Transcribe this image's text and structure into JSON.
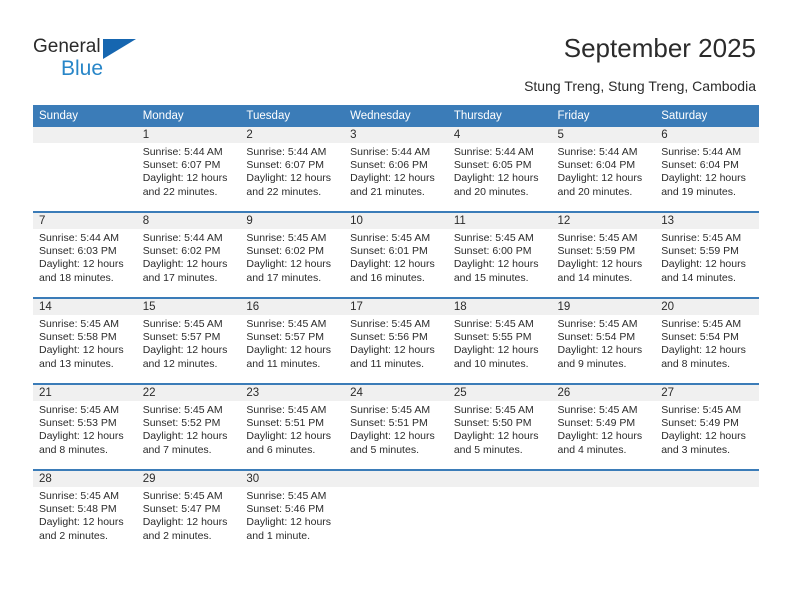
{
  "logo": {
    "word_top": "General",
    "word_bottom": "Blue",
    "triangle_color": "#1666b0",
    "blue_text_color": "#2886c8"
  },
  "header": {
    "title": "September 2025",
    "subtitle": "Stung Treng, Stung Treng, Cambodia",
    "header_bg_color": "#3b7cb8",
    "daynum_band_color": "#f0f0f0"
  },
  "calendar": {
    "weekday_headers": [
      "Sunday",
      "Monday",
      "Tuesday",
      "Wednesday",
      "Thursday",
      "Friday",
      "Saturday"
    ],
    "weeks": [
      [
        {
          "day": "",
          "empty": true
        },
        {
          "day": "1",
          "sunrise": "Sunrise: 5:44 AM",
          "sunset": "Sunset: 6:07 PM",
          "daylight": "Daylight: 12 hours and 22 minutes."
        },
        {
          "day": "2",
          "sunrise": "Sunrise: 5:44 AM",
          "sunset": "Sunset: 6:07 PM",
          "daylight": "Daylight: 12 hours and 22 minutes."
        },
        {
          "day": "3",
          "sunrise": "Sunrise: 5:44 AM",
          "sunset": "Sunset: 6:06 PM",
          "daylight": "Daylight: 12 hours and 21 minutes."
        },
        {
          "day": "4",
          "sunrise": "Sunrise: 5:44 AM",
          "sunset": "Sunset: 6:05 PM",
          "daylight": "Daylight: 12 hours and 20 minutes."
        },
        {
          "day": "5",
          "sunrise": "Sunrise: 5:44 AM",
          "sunset": "Sunset: 6:04 PM",
          "daylight": "Daylight: 12 hours and 20 minutes."
        },
        {
          "day": "6",
          "sunrise": "Sunrise: 5:44 AM",
          "sunset": "Sunset: 6:04 PM",
          "daylight": "Daylight: 12 hours and 19 minutes."
        }
      ],
      [
        {
          "day": "7",
          "sunrise": "Sunrise: 5:44 AM",
          "sunset": "Sunset: 6:03 PM",
          "daylight": "Daylight: 12 hours and 18 minutes."
        },
        {
          "day": "8",
          "sunrise": "Sunrise: 5:44 AM",
          "sunset": "Sunset: 6:02 PM",
          "daylight": "Daylight: 12 hours and 17 minutes."
        },
        {
          "day": "9",
          "sunrise": "Sunrise: 5:45 AM",
          "sunset": "Sunset: 6:02 PM",
          "daylight": "Daylight: 12 hours and 17 minutes."
        },
        {
          "day": "10",
          "sunrise": "Sunrise: 5:45 AM",
          "sunset": "Sunset: 6:01 PM",
          "daylight": "Daylight: 12 hours and 16 minutes."
        },
        {
          "day": "11",
          "sunrise": "Sunrise: 5:45 AM",
          "sunset": "Sunset: 6:00 PM",
          "daylight": "Daylight: 12 hours and 15 minutes."
        },
        {
          "day": "12",
          "sunrise": "Sunrise: 5:45 AM",
          "sunset": "Sunset: 5:59 PM",
          "daylight": "Daylight: 12 hours and 14 minutes."
        },
        {
          "day": "13",
          "sunrise": "Sunrise: 5:45 AM",
          "sunset": "Sunset: 5:59 PM",
          "daylight": "Daylight: 12 hours and 14 minutes."
        }
      ],
      [
        {
          "day": "14",
          "sunrise": "Sunrise: 5:45 AM",
          "sunset": "Sunset: 5:58 PM",
          "daylight": "Daylight: 12 hours and 13 minutes."
        },
        {
          "day": "15",
          "sunrise": "Sunrise: 5:45 AM",
          "sunset": "Sunset: 5:57 PM",
          "daylight": "Daylight: 12 hours and 12 minutes."
        },
        {
          "day": "16",
          "sunrise": "Sunrise: 5:45 AM",
          "sunset": "Sunset: 5:57 PM",
          "daylight": "Daylight: 12 hours and 11 minutes."
        },
        {
          "day": "17",
          "sunrise": "Sunrise: 5:45 AM",
          "sunset": "Sunset: 5:56 PM",
          "daylight": "Daylight: 12 hours and 11 minutes."
        },
        {
          "day": "18",
          "sunrise": "Sunrise: 5:45 AM",
          "sunset": "Sunset: 5:55 PM",
          "daylight": "Daylight: 12 hours and 10 minutes."
        },
        {
          "day": "19",
          "sunrise": "Sunrise: 5:45 AM",
          "sunset": "Sunset: 5:54 PM",
          "daylight": "Daylight: 12 hours and 9 minutes."
        },
        {
          "day": "20",
          "sunrise": "Sunrise: 5:45 AM",
          "sunset": "Sunset: 5:54 PM",
          "daylight": "Daylight: 12 hours and 8 minutes."
        }
      ],
      [
        {
          "day": "21",
          "sunrise": "Sunrise: 5:45 AM",
          "sunset": "Sunset: 5:53 PM",
          "daylight": "Daylight: 12 hours and 8 minutes."
        },
        {
          "day": "22",
          "sunrise": "Sunrise: 5:45 AM",
          "sunset": "Sunset: 5:52 PM",
          "daylight": "Daylight: 12 hours and 7 minutes."
        },
        {
          "day": "23",
          "sunrise": "Sunrise: 5:45 AM",
          "sunset": "Sunset: 5:51 PM",
          "daylight": "Daylight: 12 hours and 6 minutes."
        },
        {
          "day": "24",
          "sunrise": "Sunrise: 5:45 AM",
          "sunset": "Sunset: 5:51 PM",
          "daylight": "Daylight: 12 hours and 5 minutes."
        },
        {
          "day": "25",
          "sunrise": "Sunrise: 5:45 AM",
          "sunset": "Sunset: 5:50 PM",
          "daylight": "Daylight: 12 hours and 5 minutes."
        },
        {
          "day": "26",
          "sunrise": "Sunrise: 5:45 AM",
          "sunset": "Sunset: 5:49 PM",
          "daylight": "Daylight: 12 hours and 4 minutes."
        },
        {
          "day": "27",
          "sunrise": "Sunrise: 5:45 AM",
          "sunset": "Sunset: 5:49 PM",
          "daylight": "Daylight: 12 hours and 3 minutes."
        }
      ],
      [
        {
          "day": "28",
          "sunrise": "Sunrise: 5:45 AM",
          "sunset": "Sunset: 5:48 PM",
          "daylight": "Daylight: 12 hours and 2 minutes."
        },
        {
          "day": "29",
          "sunrise": "Sunrise: 5:45 AM",
          "sunset": "Sunset: 5:47 PM",
          "daylight": "Daylight: 12 hours and 2 minutes."
        },
        {
          "day": "30",
          "sunrise": "Sunrise: 5:45 AM",
          "sunset": "Sunset: 5:46 PM",
          "daylight": "Daylight: 12 hours and 1 minute."
        },
        {
          "day": "",
          "empty": true
        },
        {
          "day": "",
          "empty": true
        },
        {
          "day": "",
          "empty": true
        },
        {
          "day": "",
          "empty": true
        }
      ]
    ]
  }
}
